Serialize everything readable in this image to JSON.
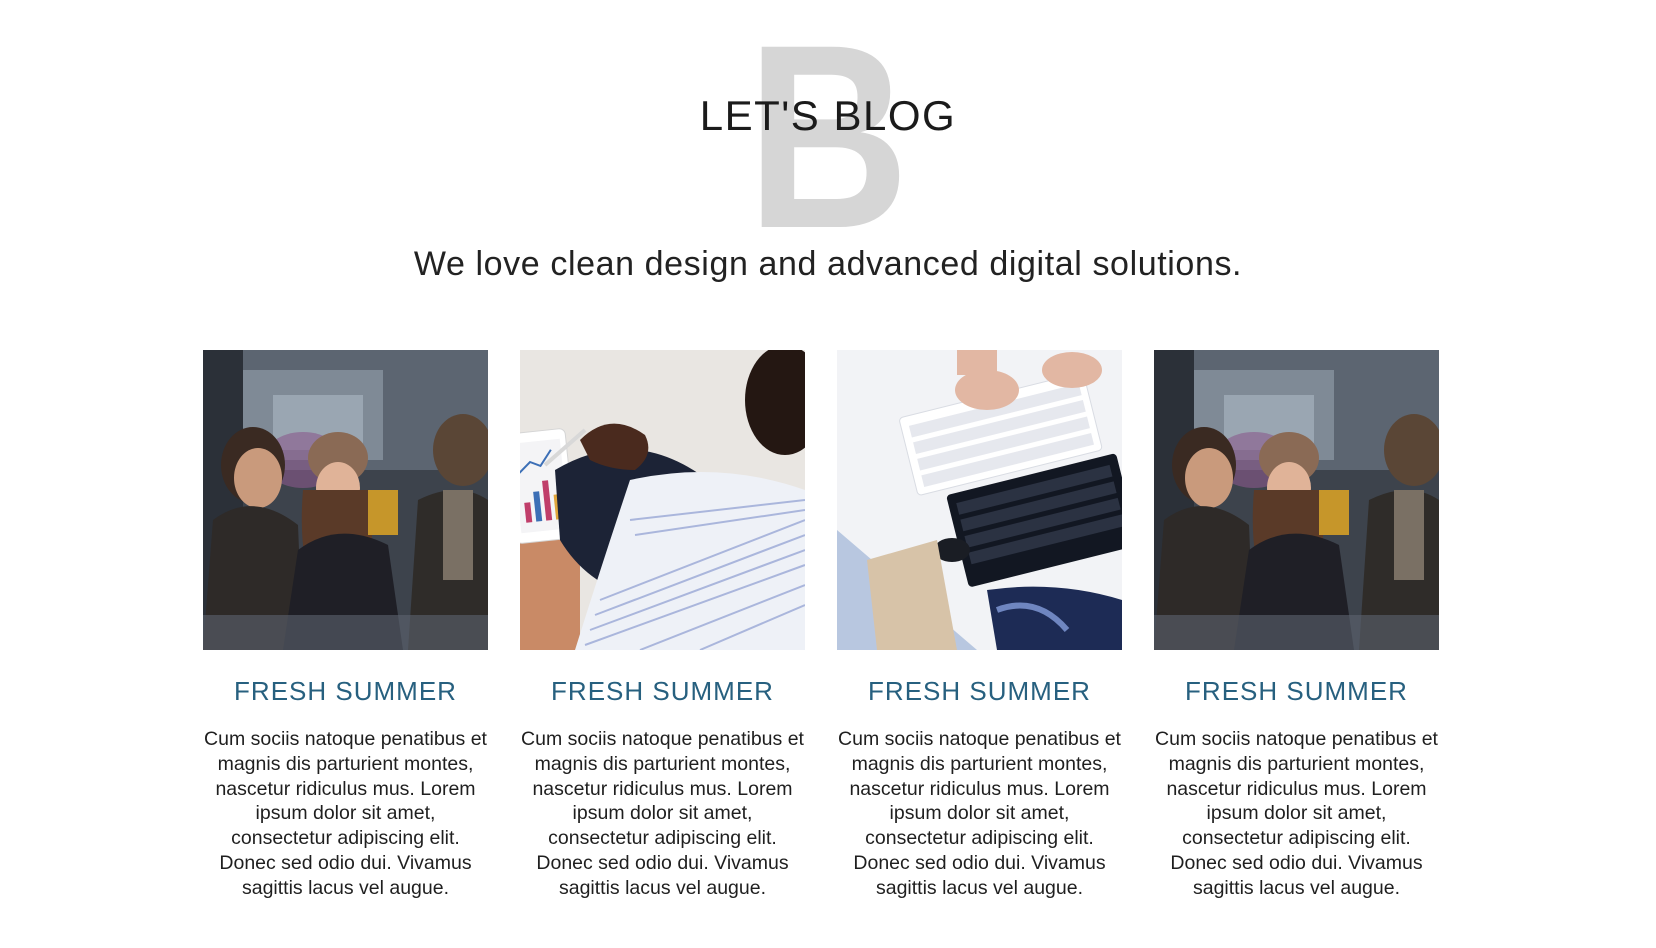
{
  "hero": {
    "background_letter": "B",
    "title": "LET'S BLOG",
    "subtitle": "We love clean design and advanced digital solutions."
  },
  "colors": {
    "accent": "#27607f",
    "background_letter": "#d6d6d6",
    "text": "#1f1f1f"
  },
  "posts": [
    {
      "image": "team-at-desk-photo",
      "title": "FRESH SUMMER",
      "text": "Cum sociis natoque penatibus et magnis dis parturient montes, nascetur ridiculus mus. Lorem ipsum dolor sit amet, consectetur adipiscing elit. Donec sed odio dui. Vivamus sagittis lacus vel augue."
    },
    {
      "image": "tablet-chart-photo",
      "title": "FRESH SUMMER",
      "text": "Cum sociis natoque penatibus et magnis dis parturient montes, nascetur ridiculus mus. Lorem ipsum dolor sit amet, consectetur adipiscing elit. Donec sed odio dui. Vivamus sagittis lacus vel augue."
    },
    {
      "image": "keyboard-desk-photo",
      "title": "FRESH SUMMER",
      "text": "Cum sociis natoque penatibus et magnis dis parturient montes, nascetur ridiculus mus. Lorem ipsum dolor sit amet, consectetur adipiscing elit. Donec sed odio dui. Vivamus sagittis lacus vel augue."
    },
    {
      "image": "team-at-desk-photo",
      "title": "FRESH SUMMER",
      "text": "Cum sociis natoque penatibus et magnis dis parturient montes, nascetur ridiculus mus. Lorem ipsum dolor sit amet, consectetur adipiscing elit. Donec sed odio dui. Vivamus sagittis lacus vel augue."
    }
  ]
}
